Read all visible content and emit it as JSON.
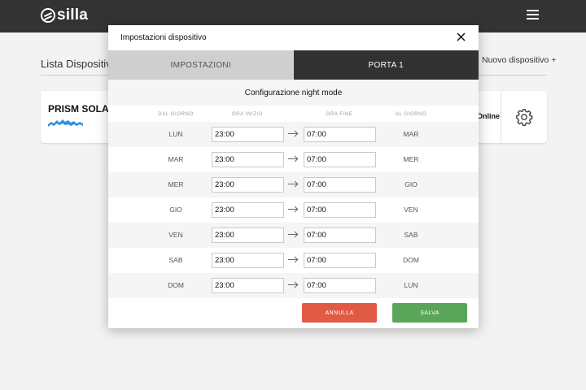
{
  "header": {
    "logo_text": "silla"
  },
  "background_page": {
    "title": "Lista Dispositivi",
    "new_device": "Nuovo dispositivo +",
    "device": {
      "name": "PRISM SOLAR",
      "status": "Online"
    }
  },
  "modal": {
    "title": "Impostazioni dispositivo",
    "tabs": [
      {
        "label": "IMPOSTAZIONI",
        "active": false
      },
      {
        "label": "PORTA 1",
        "active": true
      }
    ],
    "section_title": "Configurazione night mode",
    "columns": [
      "DAL GIORNO",
      "ORA INIZIO",
      "ORA FINE",
      "AL GIORNO"
    ],
    "rows": [
      {
        "from_day": "LUN",
        "start": "23:00",
        "end": "07:00",
        "to_day": "MAR"
      },
      {
        "from_day": "MAR",
        "start": "23:00",
        "end": "07:00",
        "to_day": "MER"
      },
      {
        "from_day": "MER",
        "start": "23:00",
        "end": "07:00",
        "to_day": "GIO"
      },
      {
        "from_day": "GIO",
        "start": "23:00",
        "end": "07:00",
        "to_day": "VEN"
      },
      {
        "from_day": "VEN",
        "start": "23:00",
        "end": "07:00",
        "to_day": "SAB"
      },
      {
        "from_day": "SAB",
        "start": "23:00",
        "end": "07:00",
        "to_day": "DOM"
      },
      {
        "from_day": "DOM",
        "start": "23:00",
        "end": "07:00",
        "to_day": "LUN"
      }
    ],
    "cancel_label": "ANNULLA",
    "save_label": "SALVA"
  },
  "colors": {
    "topbar": "#333333",
    "tab_active": "#323232",
    "tab_inactive": "#cfcfcf",
    "cancel": "#e05a44",
    "save": "#5aa55a",
    "device_wave": "#2f8fe0"
  }
}
